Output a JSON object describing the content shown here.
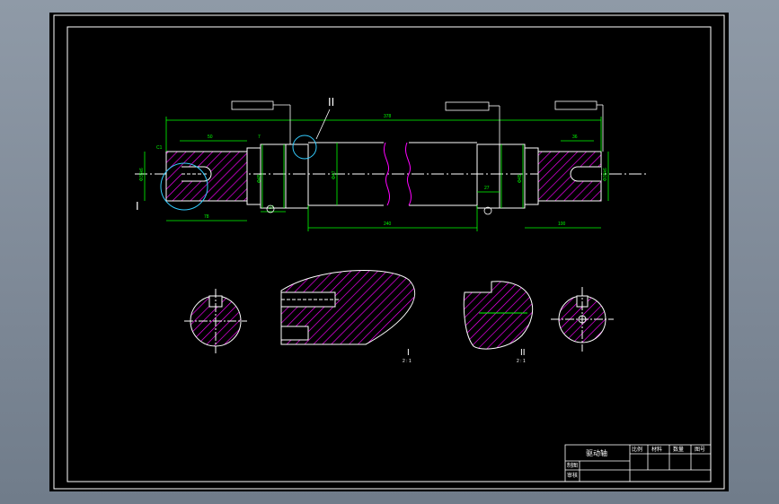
{
  "drawing": {
    "colors": {
      "background": "#000000",
      "outline": "#ffffff",
      "dimension": "#00ff00",
      "hatch": "#ff00ff",
      "centerline": "#ffffff",
      "annotation_circle": "#33ccff"
    },
    "views": {
      "section_1_label": "I",
      "section_2_label": "II",
      "section_1_scale": "2 : 1",
      "section_2_scale": "2 : 1",
      "detail_marker_1": "I",
      "detail_marker_2": "II"
    },
    "dimensions": {
      "overall_length": "378",
      "middle_length": "240",
      "left_key_length": "50",
      "right_key_length": "36",
      "left_step": "7",
      "left_journal": "78",
      "right_journal": "100",
      "dia_1": "Φ35k6",
      "dia_2": "Φ45",
      "dia_3": "Φ47",
      "dia_4": "Φ45",
      "dia_5": "Φ35k6",
      "chamfer": "C1",
      "gap_1": "27",
      "gap_2": "27"
    },
    "title_block": {
      "name": "驱动轴",
      "header_1": "比例",
      "header_2": "材料",
      "header_3": "数量",
      "header_4": "图号",
      "row_1": "制图",
      "row_2": "审核"
    }
  }
}
